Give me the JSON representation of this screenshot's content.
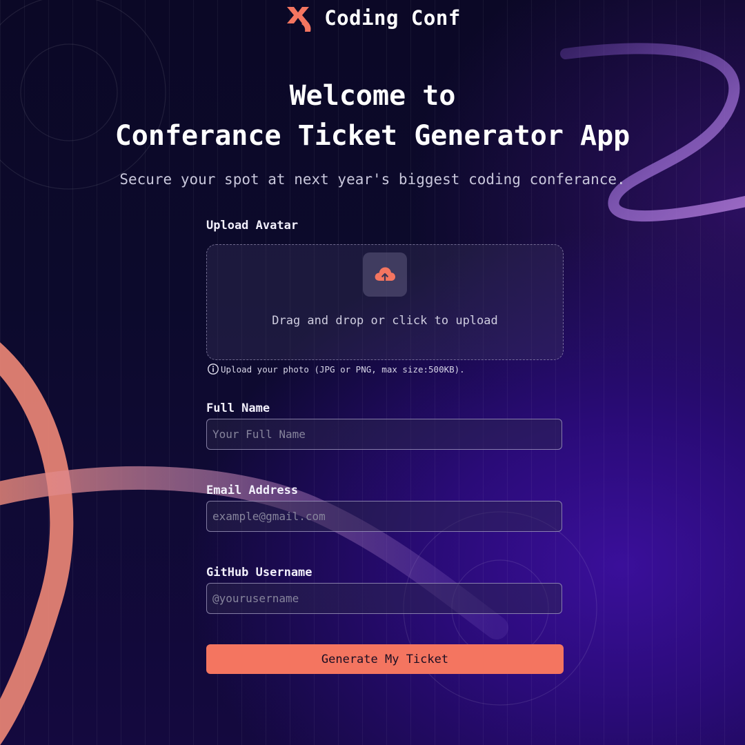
{
  "brand": {
    "name": "Coding Conf",
    "accent_color": "#f47560"
  },
  "hero": {
    "title_line1": "Welcome to",
    "title_line2": "Conferance Ticket Generator App",
    "subtitle": "Secure your spot at next year's biggest coding conferance."
  },
  "upload": {
    "label": "Upload Avatar",
    "icon": "cloud-upload-icon",
    "drop_text": "Drag and drop or click to upload",
    "hint_icon": "info-icon",
    "hint": "Upload your photo (JPG or PNG, max size:500KB)."
  },
  "fields": {
    "full_name": {
      "label": "Full Name",
      "placeholder": "Your Full Name",
      "value": ""
    },
    "email": {
      "label": "Email Address",
      "placeholder": "example@gmail.com",
      "value": ""
    },
    "github": {
      "label": "GitHub Username",
      "placeholder": "@yourusername",
      "value": ""
    }
  },
  "submit": {
    "label": "Generate My Ticket"
  }
}
